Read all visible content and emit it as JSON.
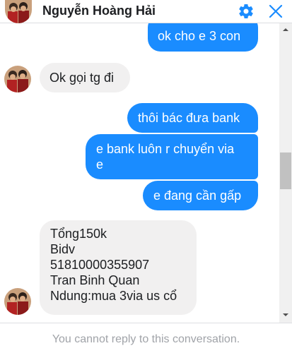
{
  "header": {
    "contact_name": "Nguyễn Hoàng Hải",
    "icons": {
      "avatar": "profile-photo",
      "settings": "gear-icon",
      "close": "close-icon"
    },
    "accent_color": "#1a8cff"
  },
  "messages": [
    {
      "direction": "outgoing",
      "text": "ok cho e 3 con"
    },
    {
      "direction": "incoming",
      "text": "Ok gọi tg đi"
    },
    {
      "direction": "outgoing",
      "text": "thôi bác đưa bank"
    },
    {
      "direction": "outgoing",
      "lines": [
        "e bank luôn r chuyển via",
        "e"
      ]
    },
    {
      "direction": "outgoing",
      "text": "e đang cần gấp"
    },
    {
      "direction": "incoming",
      "lines": [
        "Tổng150k",
        "Bidv",
        "51810000355907",
        "Tran Binh Quan",
        "Ndung:mua 3via us cổ"
      ]
    }
  ],
  "footer": {
    "notice": "You cannot reply to this conversation."
  },
  "colors": {
    "outgoing_bubble": "#1a8cff",
    "incoming_bubble": "#f1f0f0",
    "muted_text": "#a0a3a8"
  }
}
